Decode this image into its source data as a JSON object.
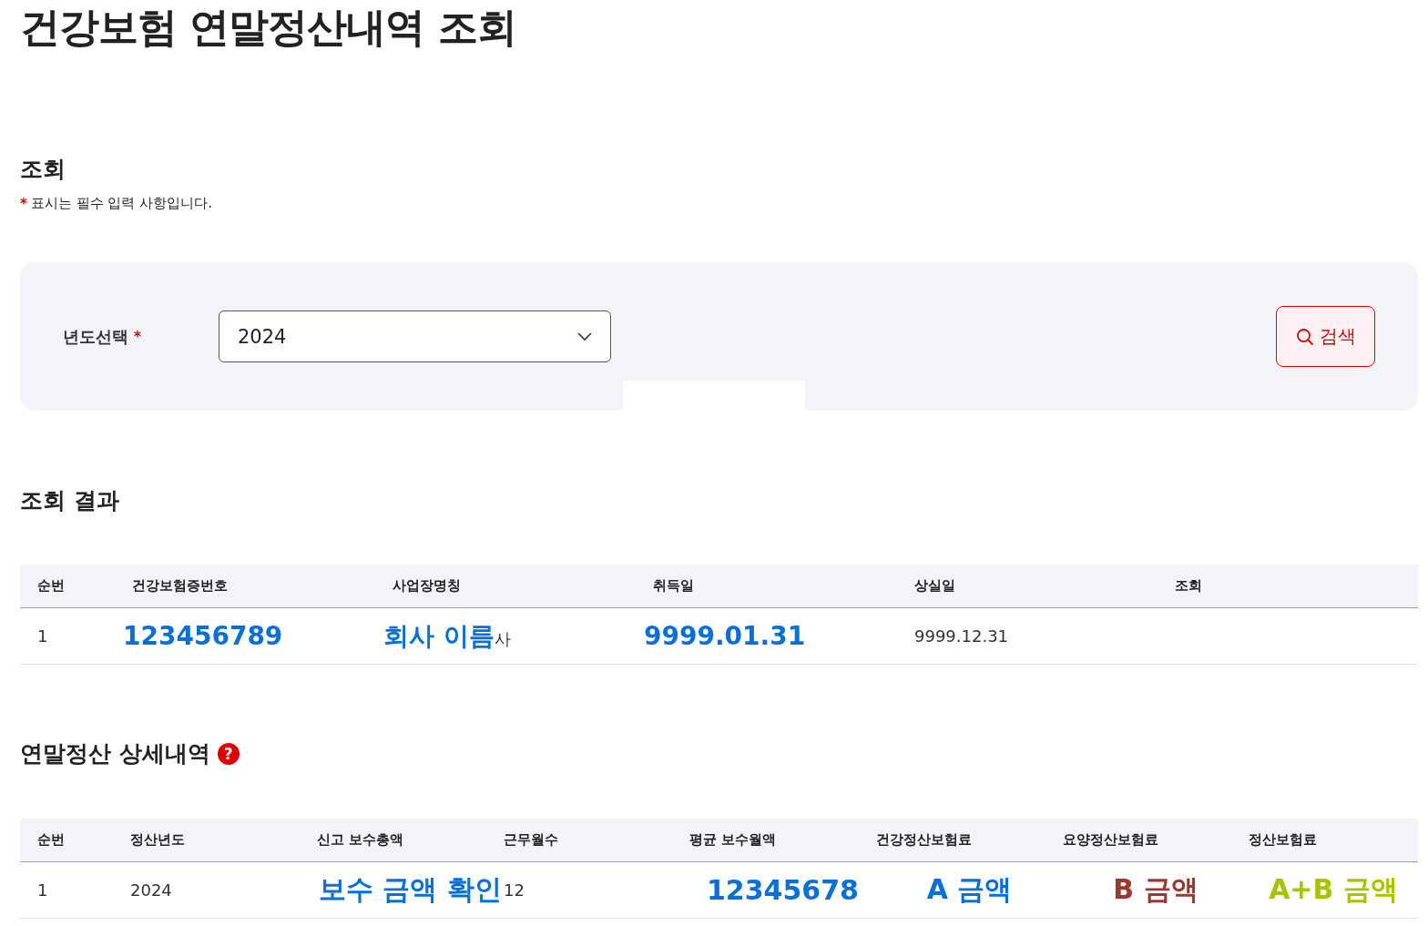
{
  "page_title": "건강보험 연말정산내역 조회",
  "search_section": {
    "title": "조회",
    "required_mark": "*",
    "note": "표시는 필수 입력 사항입니다.",
    "field_label": "년도선택",
    "field_required_mark": "*",
    "select_value": "2024",
    "button_label": "검색"
  },
  "result_section": {
    "title": "조회 결과",
    "columns": [
      "순번",
      "건강보험증번호",
      "사업장명칭",
      "취득일",
      "상실일",
      "조회"
    ],
    "rows": [
      [
        {
          "kind": "plain",
          "text": "1"
        },
        {
          "kind": "note",
          "text": "123456789",
          "color": "#0b6fd8"
        },
        {
          "kind": "note",
          "text": "회사 이름",
          "color": "#0b6fd8",
          "suffix": "사"
        },
        {
          "kind": "note",
          "text": "9999.01.31",
          "color": "#0b6fd8"
        },
        {
          "kind": "plain",
          "text": "9999.12.31"
        }
      ]
    ]
  },
  "detail_section": {
    "title": "연말정산 상세내역",
    "help_icon": "?",
    "columns": [
      "순번",
      "정산년도",
      "신고 보수총액",
      "근무월수",
      "평균 보수월액",
      "건강정산보험료",
      "요양정산보험료",
      "정산보험료"
    ],
    "rows": [
      [
        {
          "kind": "plain",
          "text": "1"
        },
        {
          "kind": "plain",
          "text": "2024"
        },
        {
          "kind": "note",
          "text": "보수 금액 확인",
          "color": "#0b6fd8"
        },
        {
          "kind": "plain",
          "text": "12"
        },
        {
          "kind": "note",
          "text": "12345678",
          "color": "#0b6fd8"
        },
        {
          "kind": "note",
          "text": "A 금액",
          "color": "#0b6fd8"
        },
        {
          "kind": "note",
          "text": "B 금액",
          "color": "#993a30"
        },
        {
          "kind": "note",
          "text": "A+B 금액",
          "color": "#a8c400"
        }
      ]
    ]
  }
}
